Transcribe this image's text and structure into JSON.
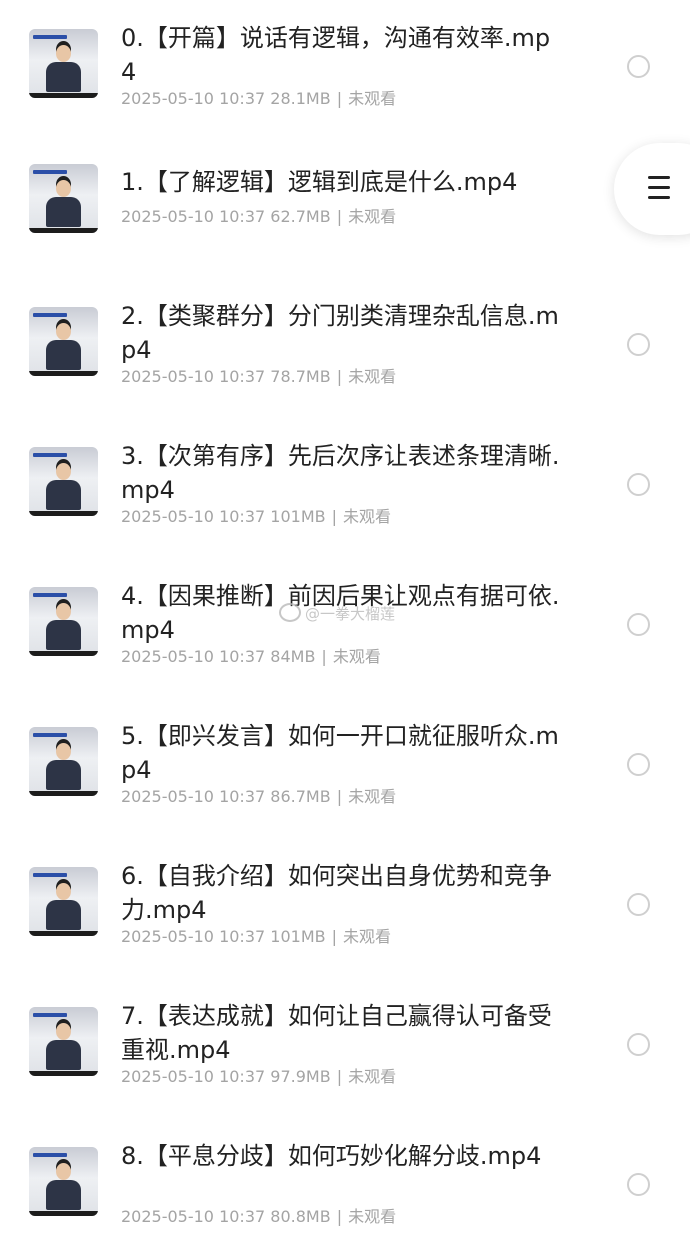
{
  "files": [
    {
      "title": "0.【开篇】说话有逻辑，沟通有效率.mp4",
      "date": "2025-05-10 10:37",
      "size": "28.1MB",
      "status": "未观看"
    },
    {
      "title": "1.【了解逻辑】逻辑到底是什么.mp4",
      "date": "2025-05-10 10:37",
      "size": "62.7MB",
      "status": "未观看"
    },
    {
      "title": "2.【类聚群分】分门别类清理杂乱信息.mp4",
      "date": "2025-05-10 10:37",
      "size": "78.7MB",
      "status": "未观看"
    },
    {
      "title": "3.【次第有序】先后次序让表述条理清晰.mp4",
      "date": "2025-05-10 10:37",
      "size": "101MB",
      "status": "未观看"
    },
    {
      "title": "4.【因果推断】前因后果让观点有据可依.mp4",
      "date": "2025-05-10 10:37",
      "size": "84MB",
      "status": "未观看"
    },
    {
      "title": "5.【即兴发言】如何一开口就征服听众.mp4",
      "date": "2025-05-10 10:37",
      "size": "86.7MB",
      "status": "未观看"
    },
    {
      "title": "6.【自我介绍】如何突出自身优势和竞争力.mp4",
      "date": "2025-05-10 10:37",
      "size": "101MB",
      "status": "未观看"
    },
    {
      "title": "7.【表达成就】如何让自己赢得认可备受重视.mp4",
      "date": "2025-05-10 10:37",
      "size": "97.9MB",
      "status": "未观看"
    },
    {
      "title": "8.【平息分歧】如何巧妙化解分歧.mp4",
      "date": "2025-05-10 10:37",
      "size": "80.8MB",
      "status": "未观看"
    }
  ],
  "meta_separator": "|",
  "floating_menu": {
    "icon": "menu-icon"
  },
  "watermark": {
    "text": "@一拳大榴莲",
    "icon": "weibo-icon"
  },
  "colors": {
    "title": "#222222",
    "meta": "#a4a4a4",
    "radio_border": "#cfcfcf",
    "background": "#ffffff"
  }
}
